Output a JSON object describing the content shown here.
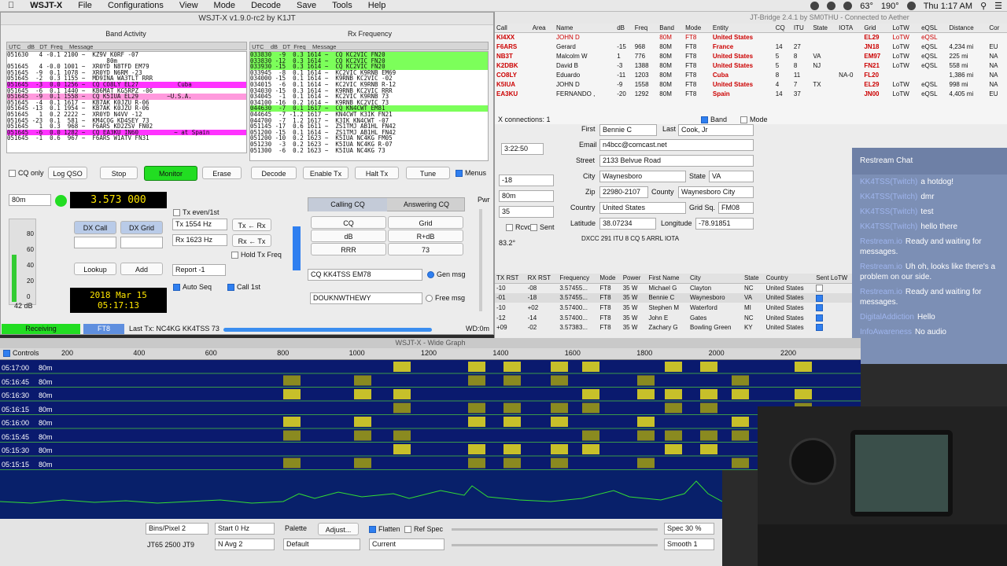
{
  "menubar": {
    "app": "WSJT-X",
    "items": [
      "File",
      "Configurations",
      "View",
      "Mode",
      "Decode",
      "Save",
      "Tools",
      "Help"
    ],
    "status": {
      "time": "Thu 1:17 AM",
      "temp": "63°",
      "angle": "190°",
      "wifi_rate": "",
      "battery": ""
    }
  },
  "wsjt": {
    "title": "WSJT-X   v1.9.0-rc2   by K1JT",
    "band_activity_title": "Band Activity",
    "rx_frequency_title": "Rx Frequency",
    "band_col_header": " UTC    dB   DT  Freq    Message",
    "rx_col_header": " UTC    dB   DT  Freq    Message",
    "band_lines": [
      {
        "t": "051630   4 -0.1 2100 ~  KZ9V K0RF -07",
        "c": "#ffffff"
      },
      {
        "t": "                            80m",
        "c": "#ffffff"
      },
      {
        "t": "051645   4 -0.0 1001 ~  XR0YD N8TFD EM79",
        "c": "#ffffff"
      },
      {
        "t": "051645  -9  0.1 1078 ~  XR0YD N6RM -23",
        "c": "#ffffff"
      },
      {
        "t": "051645  -2  0.3 1155 ~  MD9INA WA3TLT RRR",
        "c": "#ffffff"
      },
      {
        "t": "051645  -3  0.0 1256 ~  CQ CO8LY EL27           Cuba",
        "c": "#ff33ff"
      },
      {
        "t": "051645  -6  0.1 1440 ~  KB6MAT KG5RPZ -06",
        "c": "#ffffff"
      },
      {
        "t": "051645  -9  0.1 1558 ~  CQ K5IUA EL29        ~U.S.A.",
        "c": "#ff99dd"
      },
      {
        "t": "051645  -4  0.1 1617 ~  KB7AK K0JZU R-06",
        "c": "#ffffff"
      },
      {
        "t": "051645 -13  0.1 1954 ~  KB7AK K0JZU R-06",
        "c": "#ffffff"
      },
      {
        "t": "051645   1  0.2 2222 ~  XR0YD N4VV -12",
        "c": "#ffffff"
      },
      {
        "t": "051645 -23  0.1  581 ~  KM4COG KD4SEY 73",
        "c": "#ffffff"
      },
      {
        "t": "051645   1  0.3  968 ~  F6ARS KD2ZSV FN02",
        "c": "#ffffff"
      },
      {
        "t": "051645  -6  0.0 1282 ~  CQ EA3KU IN60          ~ at Spain",
        "c": "#ff33ff"
      },
      {
        "t": "051645  -1  0.6  967 ~  F6ARS W1ATV FN31",
        "c": "#ffffff"
      }
    ],
    "rx_lines": [
      {
        "t": "033830  -9  0.3 1614 ~  CQ KC2VIC FN20",
        "c": "#7cff5a"
      },
      {
        "t": "033830 -12  0.3 1614 ~  CQ KC2VIC FN20",
        "c": "#7cff5a"
      },
      {
        "t": "033930 -15  0.3 1614 ~  CQ KC2VIC FN20",
        "c": "#7cff5a"
      },
      {
        "t": "033945  -8  0.1 1614 ~  KC2VIC K9RNB EM69",
        "c": "#ffffff"
      },
      {
        "t": "034000 -15  0.1 1614 ~  K9RNB KC2VIC -02",
        "c": "#ffffff"
      },
      {
        "t": "034015  -6  0.1 1614 ~  KC2VIC K9RNB R-12",
        "c": "#ffffff"
      },
      {
        "t": "034030 -15  0.3 1614 ~  K9RNB KC2VIC RRR",
        "c": "#ffffff"
      },
      {
        "t": "034045  -1  0.1 1614 ~  KC2VIC K9RNB 73",
        "c": "#ffffff"
      },
      {
        "t": "034100 -16  0.2 1614 ~  K9RNB KC2VIC 73",
        "c": "#ffffff"
      },
      {
        "t": "044630  -7  0.1 1617 ~  CQ KN4CWT EM81",
        "c": "#7cff5a"
      },
      {
        "t": "044645  -7 -1.2 1617 ~  KN4CWT K3IK FN21",
        "c": "#ffffff"
      },
      {
        "t": "044700  -7  1.2 1617 ~  K3IK KN4CWT -07",
        "c": "#ffffff"
      },
      {
        "t": "051145 -17  0.6 1611 ~  ZS1TMJ AB1HL FN42",
        "c": "#ffffff"
      },
      {
        "t": "051200 -15  0.1 1614 ~  ZS1TMJ AB1HL FN42",
        "c": "#ffffff"
      },
      {
        "t": "051200 -10  0.2 1623 ~  K5IUA NC4KG FM05",
        "c": "#ffffff"
      },
      {
        "t": "051230  -3  0.2 1623 ~  K5IUA NC4KG R-07",
        "c": "#ffffff"
      },
      {
        "t": "051300  -6  0.2 1623 ~  K5IUA NC4KG 73",
        "c": "#ffffff"
      }
    ],
    "cq_only": "CQ only",
    "buttons": {
      "log_qso": "Log QSO",
      "stop": "Stop",
      "monitor": "Monitor",
      "erase": "Erase",
      "decode": "Decode",
      "enable_tx": "Enable Tx",
      "halt_tx": "Halt Tx",
      "tune": "Tune",
      "menus": "Menus"
    },
    "band": "80m",
    "frequency": "3.573 000",
    "tx_even": "Tx even/1st",
    "tx_hz": "Tx  1554  Hz",
    "rx_hz": "Rx  1623  Hz",
    "tx_from_rx": "Tx ← Rx",
    "rx_from_tx": "Rx ← Tx",
    "hold_tx": "Hold Tx Freq",
    "dx_call": "DX Call",
    "dx_grid": "DX Grid",
    "lookup": "Lookup",
    "add": "Add",
    "report": "Report -1",
    "auto_seq": "Auto Seq",
    "call_1st": "Call 1st",
    "date": "2018 Mar 15",
    "utc": "05:17:13",
    "db": "42 dB",
    "meter_ticks": [
      "80",
      "60",
      "40",
      "20",
      "0"
    ],
    "tabs": {
      "calling": "Calling CQ",
      "answering": "Answering CQ"
    },
    "msg_grid": [
      [
        "CQ",
        "Grid"
      ],
      [
        "dB",
        "R+dB"
      ],
      [
        "RRR",
        "73"
      ]
    ],
    "gen_msg_value": "CQ KK4TSS EM78",
    "gen_msg": "Gen msg",
    "free_msg_value": "DOUKNWTHEWY",
    "free_msg": "Free msg",
    "pwr": "Pwr",
    "status": {
      "receiving": "Receiving",
      "mode": "FT8",
      "last_tx": "Last Tx: NC4KG KK4TSS 73",
      "wd": "WD:0m"
    }
  },
  "jtbridge": {
    "title": "JT-Bridge 2.4.1 by SM0THU - Connected to Aether",
    "headers": [
      "Call",
      "Area",
      "Name",
      "dB",
      "Freq",
      "Band",
      "Mode",
      "Entity",
      "CQ",
      "ITU",
      "State",
      "IOTA",
      "Grid",
      "LoTW",
      "eQSL",
      "Distance",
      "Cor"
    ],
    "rows": [
      {
        "call": "KI4XX",
        "name": "JOHN D",
        "db": "",
        "freq": "",
        "band": "80M",
        "mode": "FT8",
        "entity": "United States",
        "cq": "",
        "itu": "",
        "state": "",
        "iota": "",
        "grid": "EL29",
        "lotw": "LoTW",
        "eqsl": "eQSL",
        "dist": "",
        "cont": "",
        "red": true
      },
      {
        "call": "F6ARS",
        "name": "Gerard",
        "db": "-15",
        "freq": "968",
        "band": "80M",
        "mode": "FT8",
        "entity": "France",
        "cq": "14",
        "itu": "27",
        "state": "",
        "iota": "",
        "grid": "JN18",
        "lotw": "LoTW",
        "eqsl": "eQSL",
        "dist": "4,234 mi",
        "cont": "EU",
        "red": true
      },
      {
        "call": "NB3T",
        "name": "Malcolm W",
        "db": "1",
        "freq": "776",
        "band": "80M",
        "mode": "FT8",
        "entity": "United States",
        "cq": "5",
        "itu": "8",
        "state": "VA",
        "iota": "",
        "grid": "EM97",
        "lotw": "LoTW",
        "eqsl": "eQSL",
        "dist": "225 mi",
        "cont": "NA",
        "red": true
      },
      {
        "call": "K2DBK",
        "name": "David B",
        "db": "-3",
        "freq": "1388",
        "band": "80M",
        "mode": "FT8",
        "entity": "United States",
        "cq": "5",
        "itu": "8",
        "state": "NJ",
        "iota": "",
        "grid": "FN21",
        "lotw": "LoTW",
        "eqsl": "eQSL",
        "dist": "558 mi",
        "cont": "NA",
        "red": true
      },
      {
        "call": "CO8LY",
        "name": "Eduardo",
        "db": "-11",
        "freq": "1203",
        "band": "80M",
        "mode": "FT8",
        "entity": "Cuba",
        "cq": "8",
        "itu": "11",
        "state": "",
        "iota": "NA-0",
        "grid": "FL20",
        "lotw": "",
        "eqsl": "",
        "dist": "1,386 mi",
        "cont": "NA",
        "red": false
      },
      {
        "call": "K5IUA",
        "name": "JOHN D",
        "db": "-9",
        "freq": "1558",
        "band": "80M",
        "mode": "FT8",
        "entity": "United States",
        "cq": "4",
        "itu": "7",
        "state": "TX",
        "iota": "",
        "grid": "EL29",
        "lotw": "LoTW",
        "eqsl": "eQSL",
        "dist": "998 mi",
        "cont": "NA",
        "red": false
      },
      {
        "call": "EA3KU",
        "name": "FERNANDO ,",
        "db": "-20",
        "freq": "1292",
        "band": "80M",
        "mode": "FT8",
        "entity": "Spain",
        "cq": "14",
        "itu": "37",
        "state": "",
        "iota": "",
        "grid": "JN00",
        "lotw": "LoTW",
        "eqsl": "eQSL",
        "dist": "4,405 mi",
        "cont": "EU",
        "red": true
      }
    ],
    "connections": "X connections: 1",
    "band_chk": "Band",
    "mode_chk": "Mode"
  },
  "logger": {
    "first_label": "First",
    "first": "Bennie C",
    "last_label": "Last",
    "last": "Cook, Jr",
    "time": "3:22:50",
    "email_label": "Email",
    "email": "n4bcc@comcast.net",
    "street_label": "Street",
    "street": "2133 Belvue Road",
    "city_label": "City",
    "city": "Waynesboro",
    "state_label": "State",
    "state": "VA",
    "zip_label": "Zip",
    "zip": "22980-2107",
    "county_label": "County",
    "county": "Waynesboro City",
    "country_label": "Country",
    "country": "United States",
    "grid_label": "Grid Sq.",
    "grid": "FM08",
    "lat_label": "Latitude",
    "lat": "38.07234",
    "lon_label": "Longitude",
    "lon": "-78.91851",
    "dxcc": "DXCC  291  ITU  8    CQ  5    ARRL         IOTA",
    "rst_left": "-18",
    "band": "80m",
    "pwr": "35",
    "rcvd": "Rcvd",
    "sent": "Sent",
    "bearing": "83.2°",
    "headers": [
      "TX RST",
      "RX RST",
      "Frequency",
      "Mode",
      "Power",
      "First Name",
      "City",
      "State",
      "Country",
      "Sent LoTW"
    ],
    "rows": [
      [
        "-10",
        "-08",
        "3.57455...",
        "FT8",
        "35 W",
        "Michael G",
        "Clayton",
        "NC",
        "United States"
      ],
      [
        "-01",
        "-18",
        "3.57455...",
        "FT8",
        "35 W",
        "Bennie C",
        "Waynesboro",
        "VA",
        "United States"
      ],
      [
        "-10",
        "+02",
        "3.57400...",
        "FT8",
        "35 W",
        "Stephen M",
        "Waterford",
        "MI",
        "United States"
      ],
      [
        "-12",
        "-14",
        "3.57400...",
        "FT8",
        "35 W",
        "John E",
        "Gates",
        "NC",
        "United States"
      ],
      [
        "+09",
        "-02",
        "3.57383...",
        "FT8",
        "35 W",
        "Zachary G",
        "Bowling Green",
        "KY",
        "United States"
      ]
    ]
  },
  "chat": {
    "title": "Restream Chat",
    "messages": [
      {
        "who": "KK4TSS(Twitch)",
        "text": "a hotdog!"
      },
      {
        "who": "KK4TSS(Twitch)",
        "text": "dmr"
      },
      {
        "who": "KK4TSS(Twitch)",
        "text": "test"
      },
      {
        "who": "KK4TSS(Twitch)",
        "text": "hello there"
      },
      {
        "who": "Restream.io",
        "text": "Ready and waiting for messages."
      },
      {
        "who": "Restream.io",
        "text": "Uh oh, looks like there's a problem on our side."
      },
      {
        "who": "Restream.io",
        "text": "Ready and waiting for messages."
      },
      {
        "who": "DigitalAddiction",
        "text": "Hello"
      },
      {
        "who": "InfoAwareness",
        "text": "No audio"
      }
    ]
  },
  "waterfall": {
    "title": "WSJT-X - Wide Graph",
    "controls": "Controls",
    "scale": [
      "200",
      "400",
      "600",
      "800",
      "1000",
      "1200",
      "1400",
      "1600",
      "1800",
      "2000",
      "2200"
    ],
    "rows": [
      {
        "t": "05:17:00",
        "b": "80m"
      },
      {
        "t": "05:16:45",
        "b": "80m"
      },
      {
        "t": "05:16:30",
        "b": "80m"
      },
      {
        "t": "05:16:15",
        "b": "80m"
      },
      {
        "t": "05:16:00",
        "b": "80m"
      },
      {
        "t": "05:15:45",
        "b": "80m"
      },
      {
        "t": "05:15:30",
        "b": "80m"
      },
      {
        "t": "05:15:15",
        "b": "80m"
      }
    ],
    "bins": "Bins/Pixel  2",
    "start": "Start  0 Hz",
    "palette": "Palette",
    "adjust": "Adjust...",
    "flatten": "Flatten",
    "ref_spec": "Ref Spec",
    "spec": "Spec  30 %",
    "jt65": "JT65  2500  JT9",
    "navg": "N Avg  2",
    "default": "Default",
    "current": "Current",
    "smooth": "Smooth  1"
  },
  "colors": {
    "green": "#22dd22",
    "magenta": "#ff33ff",
    "rxgreen": "#7cff5a",
    "waterfall": "#0a1a6e",
    "chat": "#7c8fb5"
  }
}
